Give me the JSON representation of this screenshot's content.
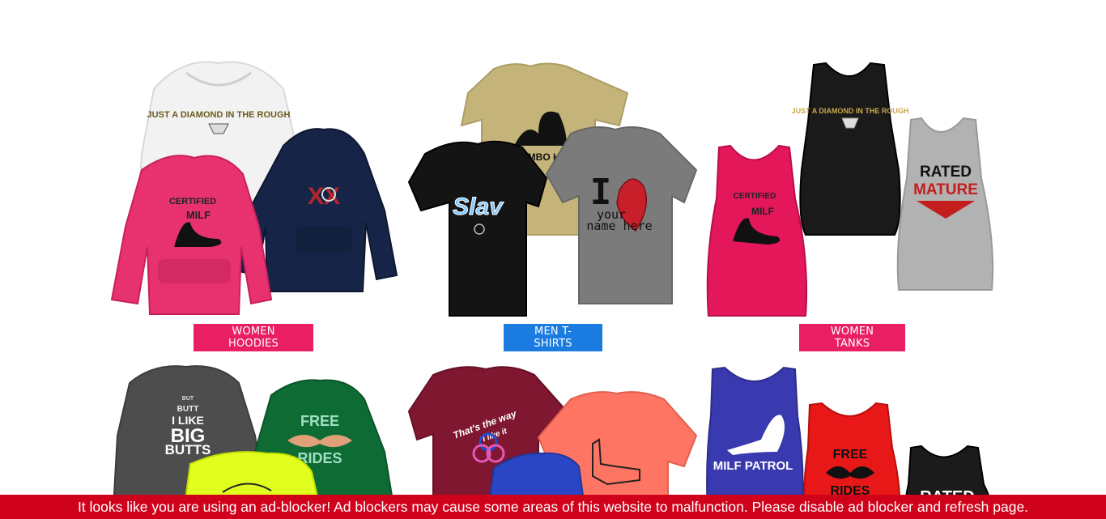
{
  "colors": {
    "pink": "#e91e63",
    "blue": "#1a7ce0",
    "banner": "#d0021b",
    "white": "#ffffff"
  },
  "categories": [
    {
      "label": "WOMEN HOODIES",
      "color": "#e91e63"
    },
    {
      "label": "MEN T-SHIRTS",
      "color": "#1a7ce0"
    },
    {
      "label": "WOMEN TANKS",
      "color": "#e91e63"
    }
  ],
  "prints": {
    "diamond": "JUST A DIAMOND IN THE ROUGH",
    "certified": "CERTIFIED",
    "milf": "MILF",
    "bimbo": "BIMBO HU",
    "i_letter": "I",
    "your": "your",
    "name_here": "name here",
    "rated": "RATED",
    "mature": "MATURE",
    "butts_small1": "BUT",
    "butts_small2": "BUTT",
    "i_like": "I LIKE",
    "big": "BIG",
    "butts": "BUTTS",
    "free": "FREE",
    "rides": "RIDES",
    "thats_the_way": "That's the way",
    "i_like_it": "I like it",
    "milf_patrol": "MILF PATROL",
    "rated_partial": "RATED"
  },
  "ad_banner": {
    "message": "It looks like you are using an ad-blocker! Ad blockers may cause some areas of this website to malfunction. Please disable ad blocker and refresh page."
  }
}
